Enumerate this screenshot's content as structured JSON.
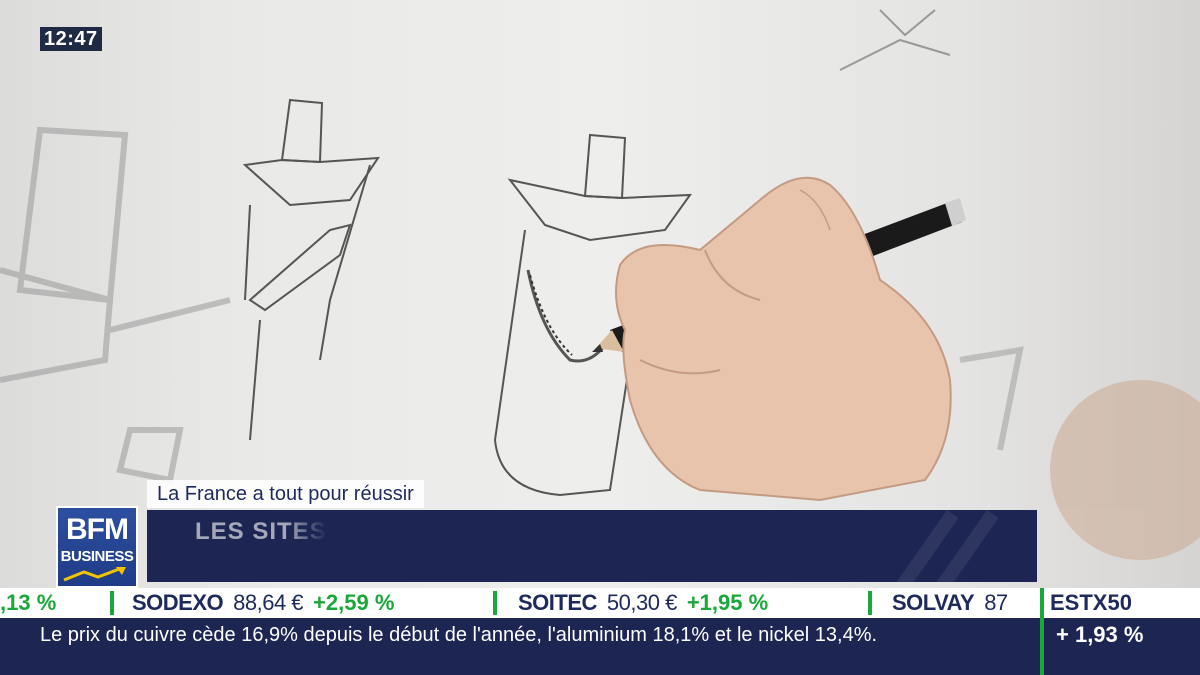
{
  "overlay": {
    "clock": "12:47",
    "program_tag": "La France a tout pour réussir",
    "headline": "LES SITES"
  },
  "logo": {
    "line1": "BFM",
    "line2": "BUSINESS"
  },
  "ticker": {
    "items": [
      {
        "name": "",
        "price": "",
        "change": ",13 %"
      },
      {
        "name": "SODEXO",
        "price": "88,64 €",
        "change": "+2,59 %"
      },
      {
        "name": "SOITEC",
        "price": "50,30 €",
        "change": "+1,95 %"
      },
      {
        "name": "SOLVAY",
        "price": "87",
        "change": ""
      }
    ]
  },
  "news": {
    "text": "Le prix du cuivre cède 16,9% depuis le début de l'année, l'aluminium 18,1% et le nickel 13,4%."
  },
  "index": {
    "name": "ESTX50",
    "change": "+ 1,93 %"
  },
  "colors": {
    "navy": "#1d2552",
    "green": "#1aa83a",
    "logo_blue": "#2d4fa0"
  }
}
